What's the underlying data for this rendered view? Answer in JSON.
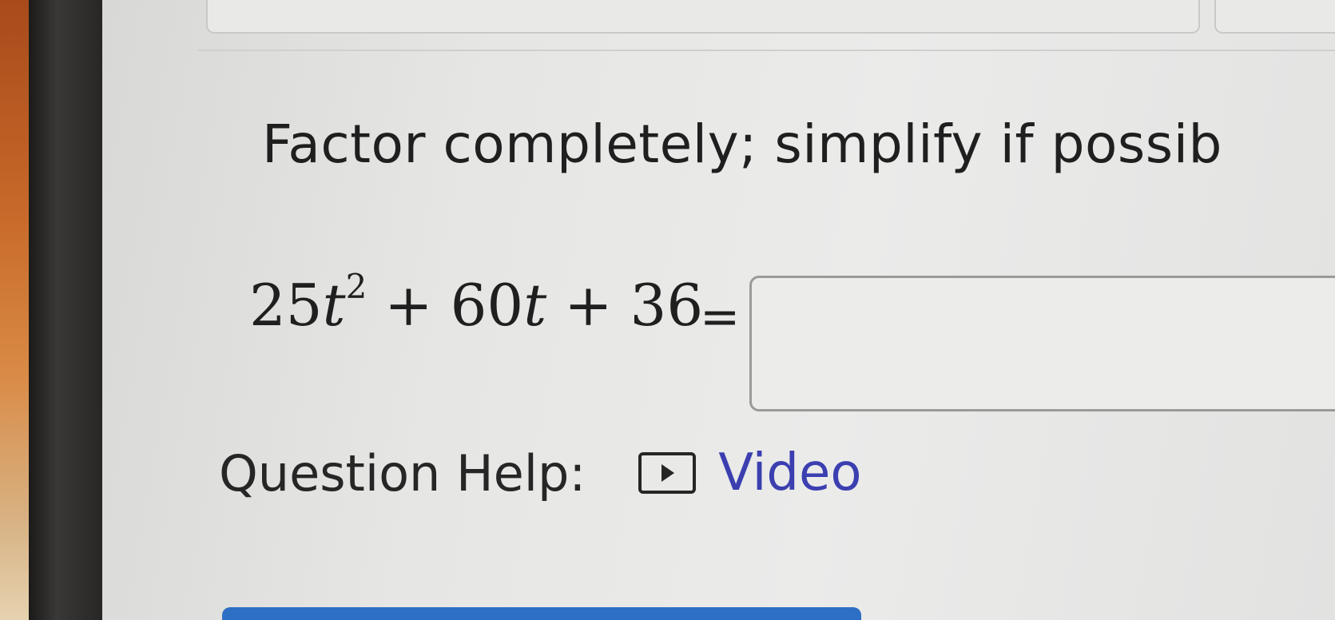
{
  "question": {
    "instruction": "Factor completely; simplify if possib",
    "equation": {
      "coef1": "25",
      "var1": "t",
      "exp1": "2",
      "plus1": "+",
      "coef2": "60",
      "var2": "t",
      "plus2": "+",
      "const": "36",
      "equals": "="
    },
    "answer": {
      "value": "",
      "placeholder": ""
    }
  },
  "help": {
    "label": "Question Help:",
    "video_label": "Video",
    "video_icon": "play-video-icon"
  },
  "colors": {
    "link": "#3b3fb0",
    "text": "#1f1f1f",
    "submit_button": "#2d6fc4"
  }
}
